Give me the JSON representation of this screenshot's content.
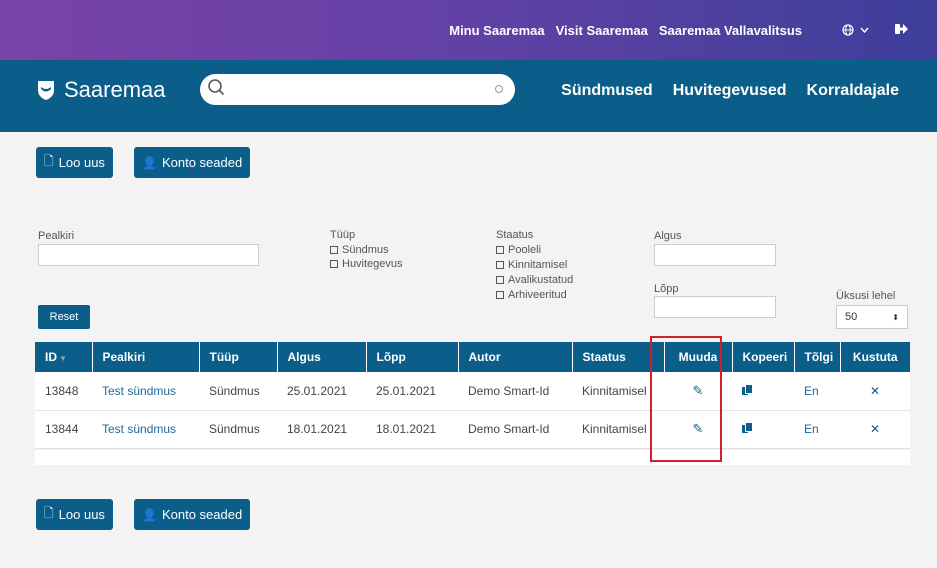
{
  "topbar": {
    "links": [
      "Minu Saaremaa",
      "Visit Saaremaa",
      "Saaremaa Vallavalitsus"
    ],
    "language_icon": "globe-icon",
    "logout_icon": "logout-icon"
  },
  "header": {
    "logo_text": "Saaremaa",
    "search_placeholder": "",
    "nav": [
      "Sündmused",
      "Huvitegevused",
      "Korraldajale"
    ]
  },
  "actions": {
    "new_label": "Loo uus",
    "account_label": "Konto seaded"
  },
  "filters": {
    "title_label": "Pealkiri",
    "title_value": "",
    "type_label": "Tüüp",
    "type_options": [
      "Sündmus",
      "Huvitegevus"
    ],
    "status_label": "Staatus",
    "status_options": [
      "Pooleli",
      "Kinnitamisel",
      "Avalikustatud",
      "Arhiveeritud"
    ],
    "start_label": "Algus",
    "end_label": "Lõpp",
    "reset_label": "Reset",
    "per_page_label": "Üksusi lehel",
    "per_page_value": "50"
  },
  "table": {
    "headers": [
      "ID",
      "Pealkiri",
      "Tüüp",
      "Algus",
      "Lõpp",
      "Autor",
      "Staatus",
      "Muuda",
      "Kopeeri",
      "Tõlgi",
      "Kustuta"
    ],
    "rows": [
      {
        "id": "13848",
        "title": "Test sündmus",
        "type": "Sündmus",
        "start": "25.01.2021",
        "end": "25.01.2021",
        "author": "Demo Smart-Id",
        "status": "Kinnitamisel",
        "translate": "En"
      },
      {
        "id": "13844",
        "title": "Test sündmus",
        "type": "Sündmus",
        "start": "18.01.2021",
        "end": "18.01.2021",
        "author": "Demo Smart-Id",
        "status": "Kinnitamisel",
        "translate": "En"
      }
    ]
  },
  "colors": {
    "primary": "#0b5e8a",
    "topbar_start": "#7a43a8",
    "topbar_end": "#3d3f9a",
    "highlight": "#d0202a"
  }
}
